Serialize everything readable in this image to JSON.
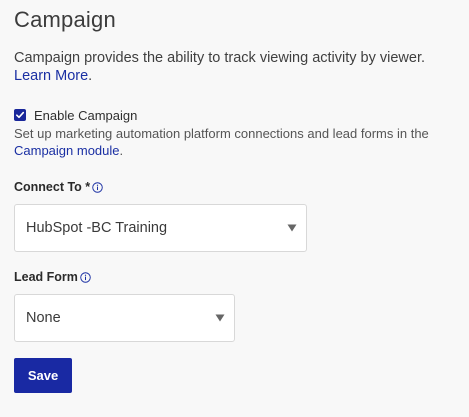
{
  "header": {
    "title": "Campaign"
  },
  "intro": {
    "text": "Campaign provides the ability to track viewing activity by viewer.",
    "link_label": "Learn More",
    "suffix": "."
  },
  "enable_campaign": {
    "label": "Enable Campaign",
    "checked": true
  },
  "helper": {
    "text": "Set up marketing automation platform connections and lead forms in the",
    "link_label": "Campaign module",
    "suffix": "."
  },
  "connect_to": {
    "label": "Connect To *",
    "icon": "info-icon",
    "selected": "HubSpot -BC Training"
  },
  "lead_form": {
    "label": "Lead Form",
    "icon": "info-icon",
    "selected": "None"
  },
  "actions": {
    "save_label": "Save"
  },
  "colors": {
    "accent": "#1929a3",
    "link": "#1a2fa3",
    "background": "#f8f8f8"
  }
}
